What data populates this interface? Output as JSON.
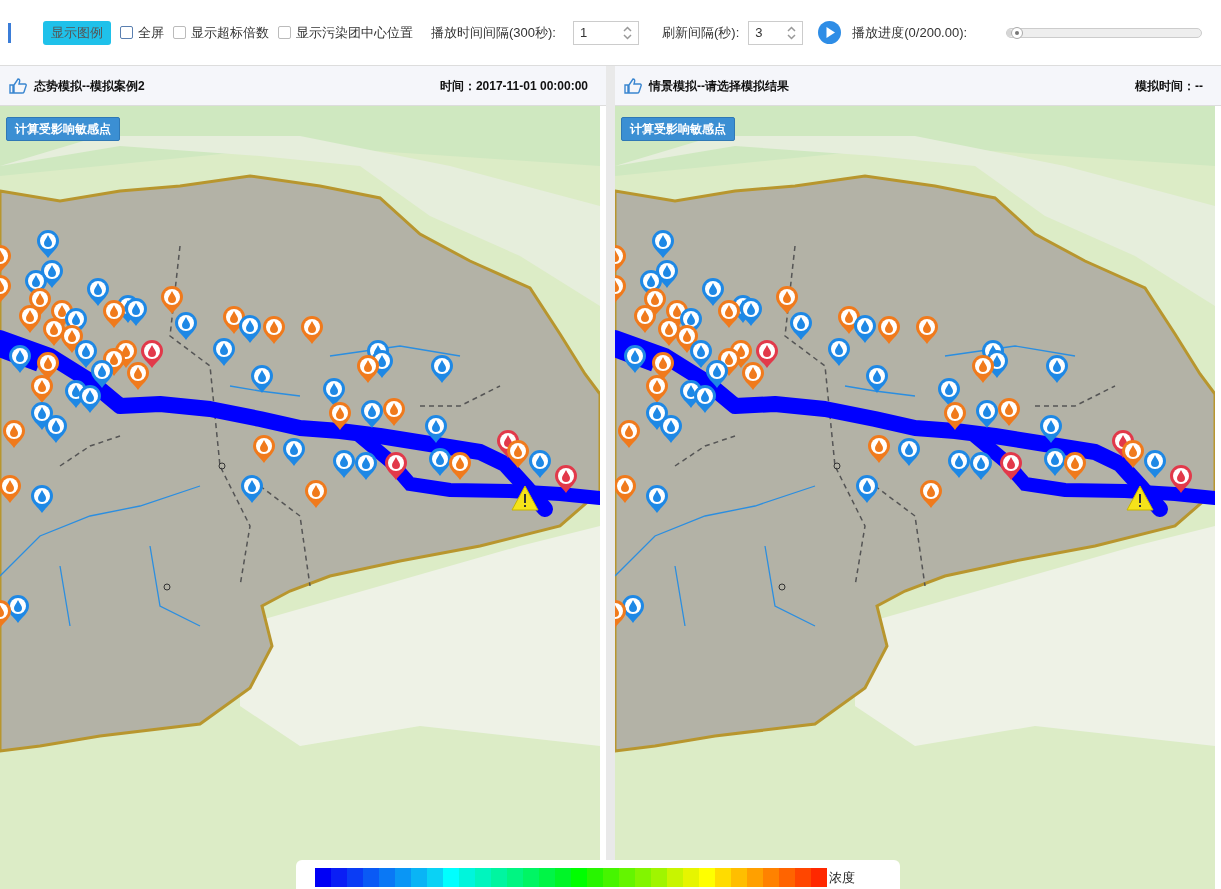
{
  "toolbar": {
    "legend_button": "显示图例",
    "checkboxes": [
      {
        "label": "全屏",
        "checked": false
      },
      {
        "label": "显示超标倍数",
        "checked": false
      },
      {
        "label": "显示污染团中心位置",
        "checked": false
      }
    ],
    "play_interval": {
      "label": "播放时间间隔(300秒):",
      "value": "1"
    },
    "refresh_interval": {
      "label": "刷新间隔(秒):",
      "value": "3"
    },
    "progress": {
      "label": "播放进度(0/200.00):",
      "level": 0
    }
  },
  "panels": [
    {
      "title": "态势模拟--模拟案例2",
      "time": "时间：2017-11-01 00:00:00",
      "button": "计算受影响敏感点"
    },
    {
      "title": "情景模拟--请选择模拟结果",
      "time": "模拟时间：--",
      "button": "计算受影响敏感点"
    }
  ],
  "legend": {
    "label": "浓度"
  }
}
